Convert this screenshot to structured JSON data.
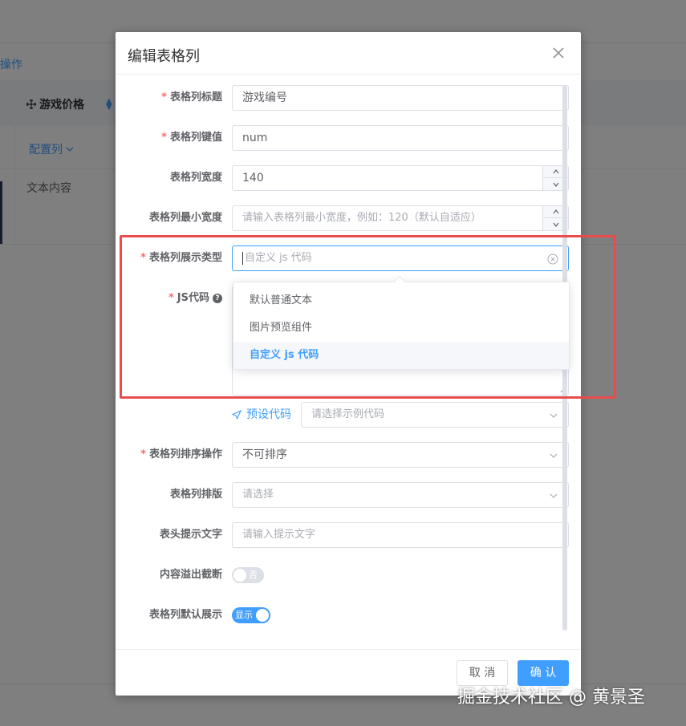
{
  "background": {
    "operation_link": "操作",
    "column_title": "游戏价格",
    "config_link": "配置列",
    "cell_text": "文本内容"
  },
  "dialog": {
    "title": "编辑表格列",
    "fields": {
      "column_title": {
        "label": "表格列标题",
        "value": "游戏编号"
      },
      "column_key": {
        "label": "表格列键值",
        "value": "num"
      },
      "column_width": {
        "label": "表格列宽度",
        "value": "140"
      },
      "column_min_width": {
        "label": "表格列最小宽度",
        "placeholder": "请输入表格列最小宽度，例如：120（默认自适应）"
      },
      "display_type": {
        "label": "表格列展示类型",
        "placeholder": "自定义 js 代码"
      },
      "js_code": {
        "label": "JS代码"
      },
      "preset": {
        "link": "预设代码",
        "placeholder": "请选择示例代码"
      },
      "sort_op": {
        "label": "表格列排序操作",
        "value": "不可排序"
      },
      "layout": {
        "label": "表格列排版",
        "placeholder": "请选择"
      },
      "header_tip": {
        "label": "表头提示文字",
        "placeholder": "请输入提示文字"
      },
      "overflow": {
        "label": "内容溢出截断",
        "switch_text": "否",
        "checked": false
      },
      "default_show": {
        "label": "表格列默认展示",
        "switch_text": "显示",
        "checked": true
      }
    },
    "dropdown_options": [
      "默认普通文本",
      "图片预览组件",
      "自定义 js 代码"
    ],
    "dropdown_selected_index": 2,
    "footer": {
      "cancel": "取 消",
      "confirm": "确 认"
    }
  },
  "watermark": "掘金技术社区 @ 黄景圣",
  "colors": {
    "accent": "#409eff",
    "required": "#f56c6c",
    "annotation": "#e84c4c"
  }
}
